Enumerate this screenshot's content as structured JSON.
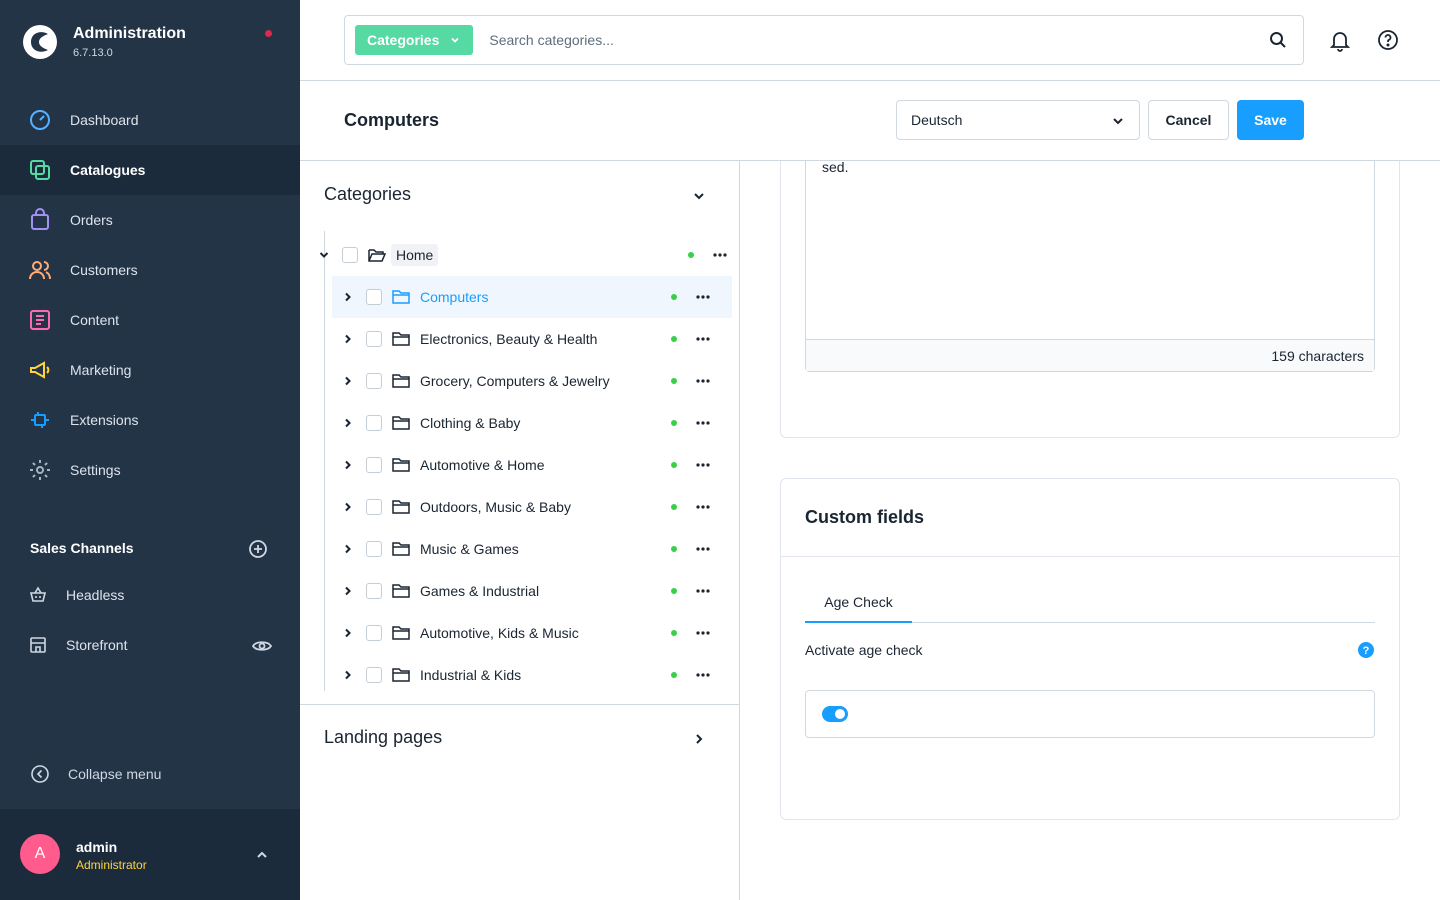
{
  "brand": {
    "title": "Administration",
    "version": "6.7.13.0"
  },
  "nav": {
    "items": [
      {
        "label": "Dashboard"
      },
      {
        "label": "Catalogues"
      },
      {
        "label": "Orders"
      },
      {
        "label": "Customers"
      },
      {
        "label": "Content"
      },
      {
        "label": "Marketing"
      },
      {
        "label": "Extensions"
      },
      {
        "label": "Settings"
      }
    ]
  },
  "sales_channels": {
    "title": "Sales Channels",
    "items": [
      {
        "label": "Headless"
      },
      {
        "label": "Storefront"
      }
    ]
  },
  "collapse_label": "Collapse menu",
  "user": {
    "initial": "A",
    "name": "admin",
    "role": "Administrator"
  },
  "search": {
    "type_label": "Categories",
    "placeholder": "Search categories..."
  },
  "smartbar": {
    "title": "Computers",
    "language": "Deutsch",
    "cancel_label": "Cancel",
    "save_label": "Save"
  },
  "tree": {
    "title": "Categories",
    "root": {
      "label": "Home"
    },
    "children": [
      {
        "label": "Computers"
      },
      {
        "label": "Electronics, Beauty & Health"
      },
      {
        "label": "Grocery, Computers & Jewelry"
      },
      {
        "label": "Clothing & Baby"
      },
      {
        "label": "Automotive & Home"
      },
      {
        "label": "Outdoors, Music & Baby"
      },
      {
        "label": "Music & Games"
      },
      {
        "label": "Games & Industrial"
      },
      {
        "label": "Automotive, Kids & Music"
      },
      {
        "label": "Industrial & Kids"
      }
    ],
    "landing_title": "Landing pages"
  },
  "description": {
    "text_tail": "sed.",
    "char_count": "159 characters"
  },
  "custom_fields": {
    "title": "Custom fields",
    "tab_label": "Age Check",
    "field_label": "Activate age check",
    "toggle_on": true
  },
  "colors": {
    "sidebar": "#243447",
    "accent": "#189eff",
    "search_type": "#57d9a3",
    "status_active": "#37d046"
  }
}
